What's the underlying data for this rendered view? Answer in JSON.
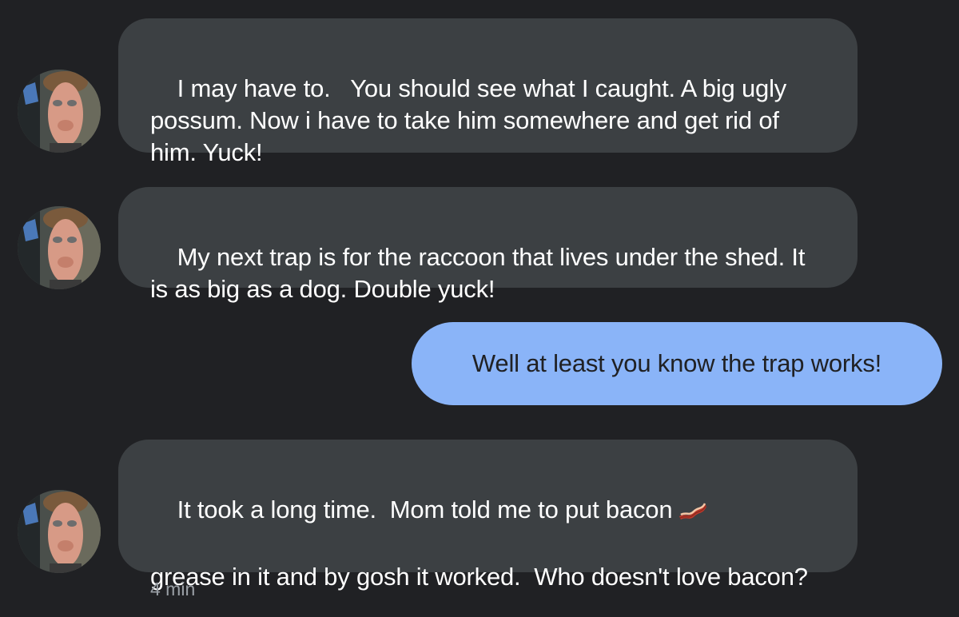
{
  "messages": [
    {
      "direction": "incoming",
      "text": "I may have to.   You should see what I caught. A big ugly possum. Now i have to take him somewhere and get rid of him. Yuck!"
    },
    {
      "direction": "incoming",
      "text": "My next trap is for the raccoon that lives under the shed. It is as big as a dog. Double yuck!"
    },
    {
      "direction": "outgoing",
      "text": "Well at least you know the trap works!"
    },
    {
      "direction": "incoming",
      "text_before_icon": "It took a long time.  Mom told me to put bacon",
      "icon": "bacon-emoji",
      "text_after_icon": "grease in it and by gosh it worked.  Who doesn't love bacon?",
      "timestamp": "4 min"
    }
  ],
  "colors": {
    "background": "#202124",
    "incoming_bubble": "#3c4043",
    "outgoing_bubble": "#8ab4f8",
    "timestamp_text": "#9aa0a6"
  }
}
